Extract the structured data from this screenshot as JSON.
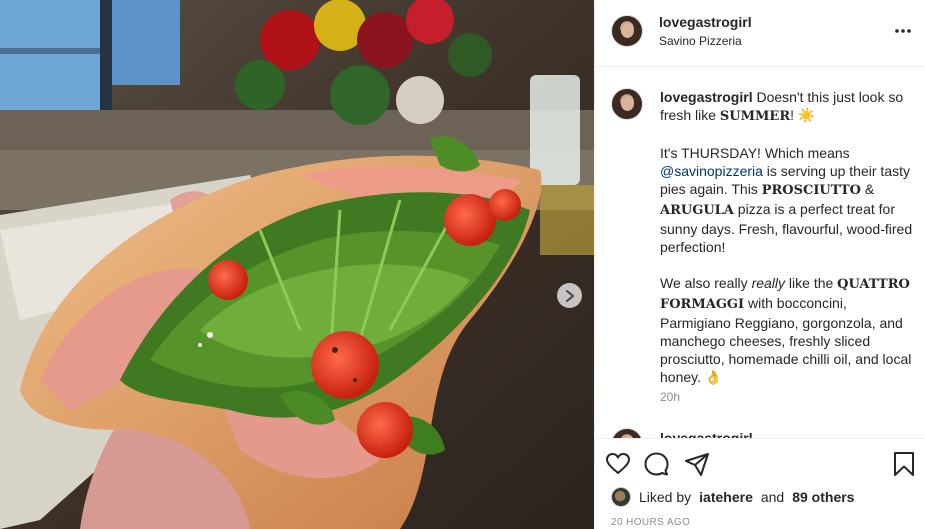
{
  "post": {
    "username": "lovegastrogirl",
    "location": "Savino Pizzeria"
  },
  "caption": {
    "author": "lovegastrogirl",
    "intro_a": "Doesn't this just look so fresh like ",
    "summer": "SUMMER",
    "intro_b": "! ",
    "sun_emoji": "☀️",
    "p2_a": "It's THURSDAY! Which means ",
    "mention": "@savinopizzeria",
    "p2_b": " is serving up their tasty pies again. This ",
    "prosciutto": "PROSCIUTTO",
    "amp": " & ",
    "arugula": "ARUGULA",
    "p2_c": " pizza is a perfect treat for sunny days. Fresh, flavourful, wood-fired perfection!",
    "p3_a": "We also really ",
    "really": "really",
    "p3_b": " like the ",
    "quattro": "QUATTRO FORMAGGI",
    "p3_c": " with bocconcini, Parmigiano Reggiano, gorgonzola, and manchego cheeses, freshly sliced prosciutto, homemade chilli oil, and local honey. ",
    "ok_emoji": "👌",
    "time": "20h"
  },
  "next_comment": {
    "author_fragment": "lovegastrogirl"
  },
  "likes": {
    "prefix": "Liked by",
    "user": "iatehere",
    "and": "and",
    "others": "89 others"
  },
  "posted": "20 HOURS AGO",
  "icons": {
    "like": "heart-icon",
    "comment": "comment-icon",
    "share": "share-icon",
    "save": "bookmark-icon",
    "more": "more-options-icon",
    "next": "chevron-right-icon"
  },
  "colors": {
    "text": "#262626",
    "secondary": "#8e8e8e",
    "link": "#00376b",
    "border": "#efefef"
  }
}
